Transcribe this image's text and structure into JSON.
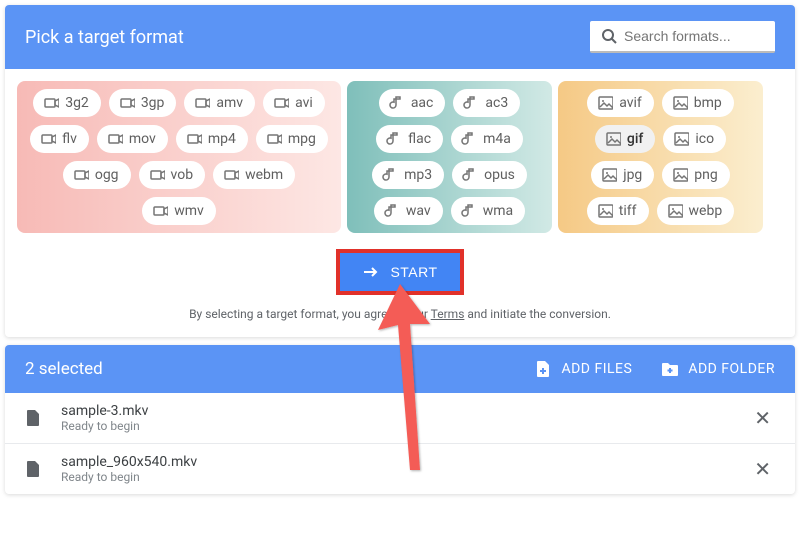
{
  "header": {
    "title": "Pick a target format",
    "search_placeholder": "Search formats..."
  },
  "groups": {
    "video": [
      "3g2",
      "3gp",
      "amv",
      "avi",
      "flv",
      "mov",
      "mp4",
      "mpg",
      "ogg",
      "vob",
      "webm",
      "wmv"
    ],
    "audio": [
      "aac",
      "ac3",
      "flac",
      "m4a",
      "mp3",
      "opus",
      "wav",
      "wma"
    ],
    "image": [
      "avif",
      "bmp",
      "gif",
      "ico",
      "jpg",
      "png",
      "tiff",
      "webp"
    ]
  },
  "selected_format": "gif",
  "start_label": "START",
  "terms": {
    "prefix": "By selecting a target format, you agree to our ",
    "link": "Terms",
    "suffix": " and initiate the conversion."
  },
  "selection": {
    "count_label": "2 selected",
    "add_files": "ADD FILES",
    "add_folder": "ADD FOLDER"
  },
  "files": [
    {
      "name": "sample-3.mkv",
      "status": "Ready to begin"
    },
    {
      "name": "sample_960x540.mkv",
      "status": "Ready to begin"
    }
  ]
}
